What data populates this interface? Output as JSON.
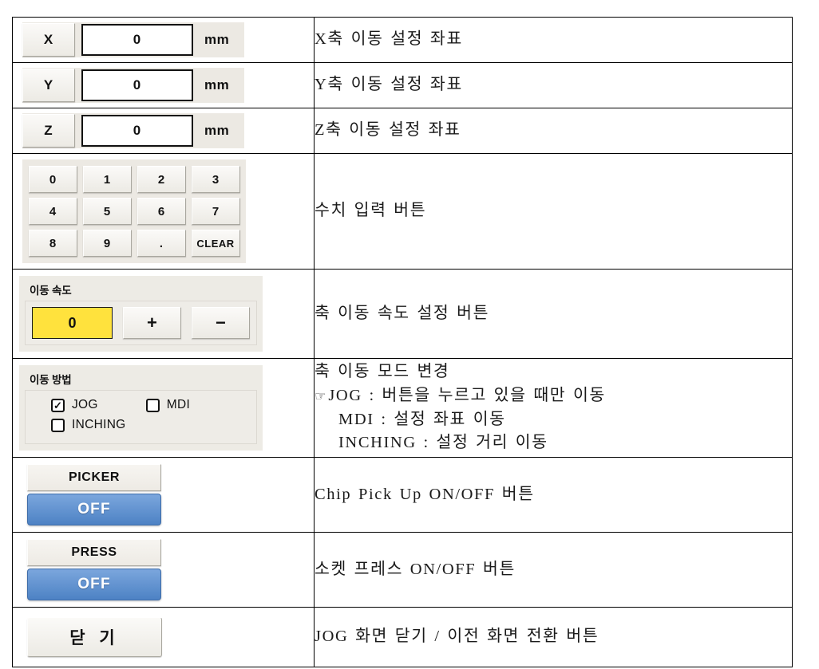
{
  "rows": [
    {
      "id": "x-axis",
      "control": {
        "axis_label": "X",
        "value": "0",
        "unit": "mm"
      },
      "description": {
        "lines": [
          "X축 이동 설정 좌표"
        ]
      }
    },
    {
      "id": "y-axis",
      "control": {
        "axis_label": "Y",
        "value": "0",
        "unit": "mm"
      },
      "description": {
        "lines": [
          "Y축 이동 설정 좌표"
        ]
      }
    },
    {
      "id": "z-axis",
      "control": {
        "axis_label": "Z",
        "value": "0",
        "unit": "mm"
      },
      "description": {
        "lines": [
          "Z축 이동 설정 좌표"
        ]
      }
    },
    {
      "id": "keypad",
      "control": {
        "keys": [
          [
            "0",
            "1",
            "2",
            "3"
          ],
          [
            "4",
            "5",
            "6",
            "7"
          ],
          [
            "8",
            "9",
            ".",
            "CLEAR"
          ]
        ]
      },
      "description": {
        "lines": [
          "수치 입력 버튼"
        ]
      }
    },
    {
      "id": "move-speed",
      "control": {
        "group_title": "이동 속도",
        "value": "0",
        "plus_label": "+",
        "minus_label": "−",
        "highlight_color": "#ffe23d"
      },
      "description": {
        "lines": [
          "축 이동 속도 설정 버튼"
        ]
      }
    },
    {
      "id": "move-method",
      "control": {
        "group_title": "이동 방법",
        "options": [
          {
            "label": "JOG",
            "checked": true
          },
          {
            "label": "MDI",
            "checked": false
          },
          {
            "label": "INCHING",
            "checked": false
          }
        ],
        "check_glyph": "✓"
      },
      "description": {
        "lines": [
          "축 이동 모드 변경",
          "JOG : 버튼을 누르고 있을 때만 이동",
          "MDI : 설정 좌표 이동",
          "INCHING : 설정 거리 이동"
        ],
        "pointer_glyph": "☞"
      }
    },
    {
      "id": "picker",
      "control": {
        "title": "PICKER",
        "state": "OFF",
        "state_color": "#5b8ed2"
      },
      "description": {
        "lines": [
          "Chip Pick Up  ON/OFF 버튼"
        ]
      }
    },
    {
      "id": "press",
      "control": {
        "title": "PRESS",
        "state": "OFF",
        "state_color": "#5b8ed2"
      },
      "description": {
        "lines": [
          "소켓 프레스 ON/OFF 버튼"
        ]
      }
    },
    {
      "id": "close",
      "control": {
        "label": "닫 기"
      },
      "description": {
        "lines": [
          "JOG 화면 닫기 / 이전 화면 전환 버튼"
        ]
      }
    }
  ]
}
